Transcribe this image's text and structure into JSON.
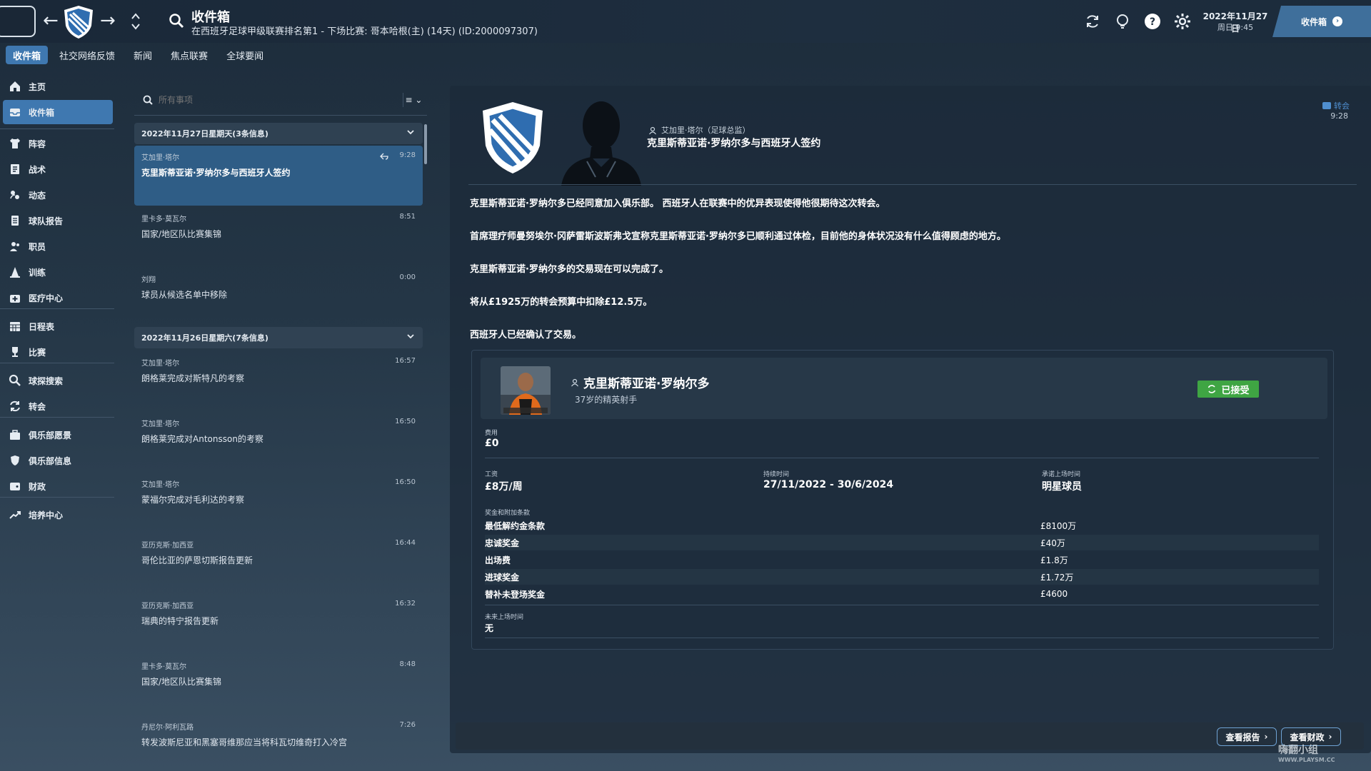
{
  "header": {
    "title": "收件箱",
    "subtitle": "在西班牙足球甲级联赛排名第1 - 下场比赛: 哥本哈根(主) (14天) (ID:2000097307)",
    "date": "2022年11月27日",
    "time": "周日 9:45",
    "inbox_button": "收件箱"
  },
  "subtabs": [
    "收件箱",
    "社交网络反馈",
    "新闻",
    "焦点联赛",
    "全球要闻"
  ],
  "sidebar": {
    "items": [
      "主页",
      "收件箱",
      "阵容",
      "战术",
      "动态",
      "球队报告",
      "职员",
      "训练",
      "医疗中心",
      "日程表",
      "比赛",
      "球探搜索",
      "转会",
      "俱乐部愿景",
      "俱乐部信息",
      "财政",
      "培养中心"
    ],
    "active": "收件箱"
  },
  "list": {
    "search_placeholder": "所有事项",
    "filter_label": "≡",
    "groups": [
      {
        "heading": "2022年11月27日星期天(3条信息)",
        "messages": [
          {
            "sender": "艾加里·塔尔",
            "title": "克里斯蒂亚诺·罗纳尔多与西班牙人签约",
            "time": "9:28"
          },
          {
            "sender": "里卡多·莫瓦尔",
            "title": "国家/地区队比赛集锦",
            "time": "8:51"
          },
          {
            "sender": "刘翔",
            "title": "球员从候选名单中移除",
            "time": "0:00"
          }
        ]
      },
      {
        "heading": "2022年11月26日星期六(7条信息)",
        "messages": [
          {
            "sender": "艾加里·塔尔",
            "title": "朗格莱完成对斯特凡的考察",
            "time": "16:57"
          },
          {
            "sender": "艾加里·塔尔",
            "title": "朗格莱完成对Antonsson的考察",
            "time": "16:50"
          },
          {
            "sender": "艾加里·塔尔",
            "title": "蒙福尔完成对毛利达的考察",
            "time": "16:50"
          },
          {
            "sender": "亚历克斯·加西亚",
            "title": "哥伦比亚的萨恩切斯报告更新",
            "time": "16:44"
          },
          {
            "sender": "亚历克斯·加西亚",
            "title": "瑞典的特宁报告更新",
            "time": "16:32"
          },
          {
            "sender": "里卡多·莫瓦尔",
            "title": "国家/地区队比赛集锦",
            "time": "8:48"
          },
          {
            "sender": "丹尼尔·阿利瓦路",
            "title": "转发波斯尼亚和黑塞哥维那应当将科瓦切维奇打入冷宫",
            "time": "7:26"
          }
        ]
      }
    ]
  },
  "detail": {
    "sender": "艾加里·塔尔（足球总监）",
    "headline": "克里斯蒂亚诺·罗纳尔多与西班牙人签约",
    "tag": "转会",
    "time": "9:28",
    "paragraphs": [
      "克里斯蒂亚诺·罗纳尔多已经同意加入俱乐部。 西班牙人在联赛中的优异表现使得他很期待这次转会。",
      "首席理疗师曼努埃尔·冈萨雷斯波斯弗戈宣称克里斯蒂亚诺·罗纳尔多已顺利通过体检，目前他的身体状况没有什么值得顾虑的地方。",
      "克里斯蒂亚诺·罗纳尔多的交易现在可以完成了。",
      "将从£1925万的转会预算中扣除£12.5万。",
      "西班牙人已经确认了交易。"
    ],
    "contract": {
      "player_name": "克里斯蒂亚诺·罗纳尔多",
      "player_desc": "37岁的精英射手",
      "status": "已接受",
      "fee_label": "费用",
      "fee": "£0",
      "wage_label": "工资",
      "wage": "£8万/周",
      "duration_label": "持续时间",
      "duration": "27/11/2022 - 30/6/2024",
      "promise_label": "承诺上场时间",
      "promise": "明星球员",
      "bonus_label": "奖金和附加条款",
      "bonuses": [
        {
          "name": "最低解约金条款",
          "value": "£8100万"
        },
        {
          "name": "忠诚奖金",
          "value": "£40万"
        },
        {
          "name": "出场费",
          "value": "£1.8万"
        },
        {
          "name": "进球奖金",
          "value": "£1.72万"
        },
        {
          "name": "替补未登场奖金",
          "value": "£4600"
        }
      ],
      "future_label": "未来上场时间",
      "future": "无"
    },
    "actions": [
      "查看报告",
      "查看财政"
    ]
  },
  "watermark": {
    "text": "嗨翻小组",
    "url": "WWW.PLAYSM.CC"
  },
  "colors": {
    "accent": "#3f78b0",
    "accepted": "#3fa543",
    "panel": "#1c2a3a"
  }
}
